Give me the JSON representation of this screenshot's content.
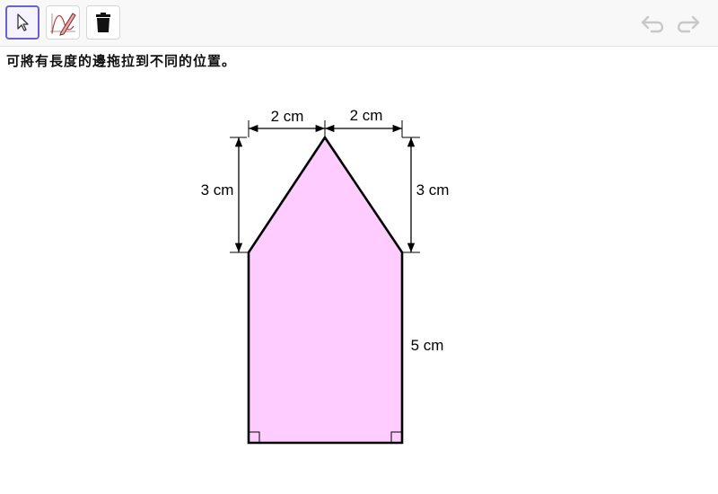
{
  "toolbar": {
    "tools": [
      {
        "name": "move-tool",
        "icon": "cursor-arrow-icon",
        "active": true
      },
      {
        "name": "pen-tool",
        "icon": "pen-graph-icon",
        "active": false
      },
      {
        "name": "delete-tool",
        "icon": "trash-icon",
        "active": false
      }
    ],
    "undo_icon": "undo-icon",
    "redo_icon": "redo-icon"
  },
  "instruction": "可將有長度的邊拖拉到不同的位置。",
  "figure": {
    "fill_color": "#ffccff",
    "stroke_color": "#000000",
    "labels": {
      "top_left_width": "2 cm",
      "top_right_width": "2 cm",
      "left_height": "3 cm",
      "right_height": "3 cm",
      "right_side": "5 cm"
    }
  }
}
